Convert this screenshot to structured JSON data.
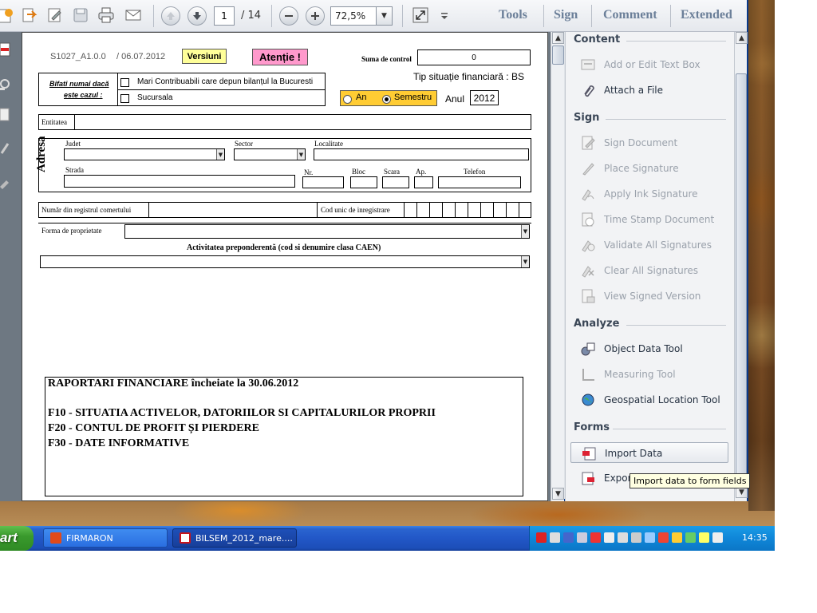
{
  "toolbar": {
    "page_current": "1",
    "page_total": "/  14",
    "zoom": "72,5%",
    "tabs": [
      "Tools",
      "Sign",
      "Comment",
      "Extended"
    ]
  },
  "document": {
    "form_code": "S1027_A1.0.0",
    "form_date": "/ 06.07.2012",
    "versions_btn": "Versiuni",
    "attention_btn": "Atenție !",
    "checksum_label": "Suma de control",
    "checksum_value": "0",
    "tick_if": "Bifati numai dacă",
    "this_case": "este cazul :",
    "opt_large": "Mari Contribuabili care depun bilanțul la Bucuresti",
    "opt_branch": "Sucursala",
    "fin_type": "Tip situație financiară : BS",
    "radio_year": "An",
    "radio_semester": "Semestru",
    "year_label": "Anul",
    "year_value": "2012",
    "entity": "Entitatea",
    "address": "Adresa",
    "county": "Judet",
    "sector": "Sector",
    "locality": "Localitate",
    "street": "Strada",
    "number": "Nr.",
    "block": "Bloc",
    "stair": "Scara",
    "apartment": "Ap.",
    "phone": "Telefon",
    "trade_register": "Număr din registrul comertului",
    "unique_code": "Cod unic de inregistrare",
    "ownership": "Forma de proprietate",
    "main_activity": "Activitatea preponderentă (cod si denumire clasa CAEN)",
    "report_title": "RAPORTARI FINANCIARE încheiate la 30.06.2012",
    "report_lines": [
      "F10 - SITUATIA ACTIVELOR, DATORIILOR SI CAPITALURILOR PROPRII",
      "F20 - CONTUL DE PROFIT ȘI PIERDERE",
      "F30 - DATE INFORMATIVE"
    ]
  },
  "tools_pane": {
    "sections": [
      {
        "title": "Content",
        "tools": [
          {
            "label": "Add or Edit Text Box",
            "icon": "textbox-icon",
            "enabled": false
          },
          {
            "label": "Attach a File",
            "icon": "paperclip-icon",
            "enabled": true
          }
        ]
      },
      {
        "title": "Sign",
        "tools": [
          {
            "label": "Sign Document",
            "icon": "sign-document-icon",
            "enabled": false
          },
          {
            "label": "Place Signature",
            "icon": "pen-icon",
            "enabled": false
          },
          {
            "label": "Apply Ink Signature",
            "icon": "ink-signature-icon",
            "enabled": false
          },
          {
            "label": "Time Stamp Document",
            "icon": "timestamp-icon",
            "enabled": false
          },
          {
            "label": "Validate All Signatures",
            "icon": "validate-signature-icon",
            "enabled": false
          },
          {
            "label": "Clear All Signatures",
            "icon": "clear-signature-icon",
            "enabled": false
          },
          {
            "label": "View Signed Version",
            "icon": "signed-version-icon",
            "enabled": false
          }
        ]
      },
      {
        "title": "Analyze",
        "tools": [
          {
            "label": "Object Data Tool",
            "icon": "object-data-icon",
            "enabled": true
          },
          {
            "label": "Measuring Tool",
            "icon": "ruler-icon",
            "enabled": false
          },
          {
            "label": "Geospatial Location Tool",
            "icon": "globe-icon",
            "enabled": true
          }
        ]
      },
      {
        "title": "Forms",
        "tools": [
          {
            "label": "Import Data",
            "icon": "import-data-icon",
            "enabled": true,
            "selected": true
          },
          {
            "label": "Export Data",
            "icon": "export-data-icon",
            "enabled": true
          }
        ]
      }
    ],
    "tooltip": "Import data to form fields"
  },
  "taskbar": {
    "start": "art",
    "tasks": [
      {
        "label": "FIRMARON",
        "icon": "office-icon"
      },
      {
        "label": "BILSEM_2012_mare....",
        "icon": "pdf-icon"
      }
    ],
    "clock": "14:35"
  },
  "colors": {
    "accent_blue": "#2257c7",
    "versions_yellow": "#ffff99",
    "attention_pink": "#ff99cc",
    "radio_orange": "#ffcc33"
  }
}
